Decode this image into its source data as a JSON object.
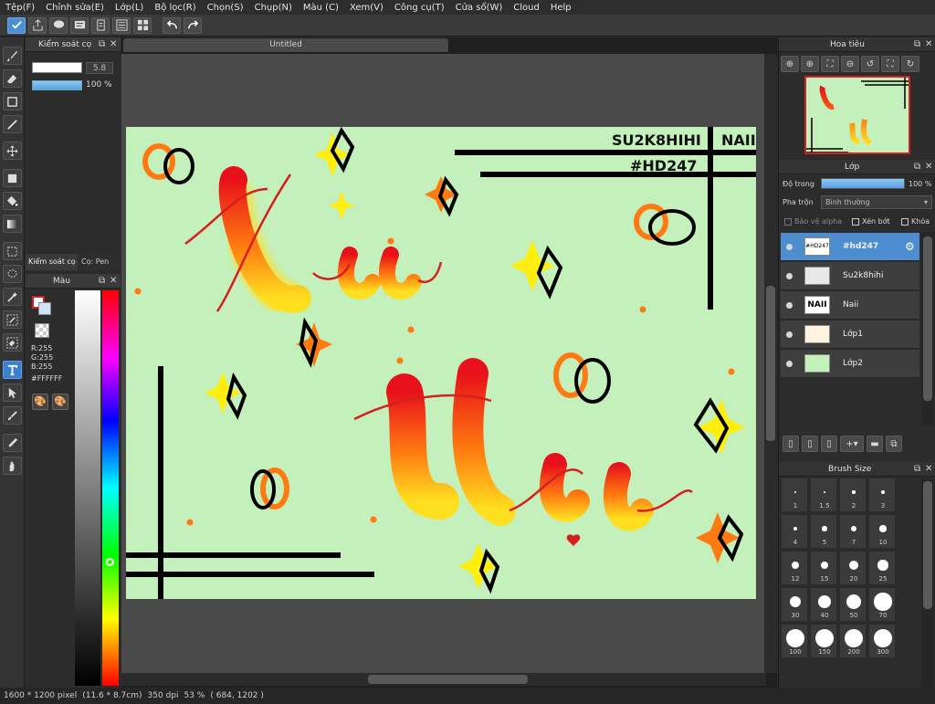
{
  "menu": [
    "Tệp(F)",
    "Chỉnh sửa(E)",
    "Lớp(L)",
    "Bộ lọc(R)",
    "Chọn(S)",
    "Chụp(N)",
    "Màu (C)",
    "Xem(V)",
    "Công cụ(T)",
    "Cửa sổ(W)",
    "Cloud",
    "Help"
  ],
  "brush_control": {
    "title": "Kiểm soát cọ",
    "size": "5.8",
    "opacity": "100 %",
    "tab_brush": "Kiểm soát cọ",
    "tab_pen": "Cọ: Pen"
  },
  "color_panel": {
    "title": "Màu",
    "r": "R:255",
    "g": "G:255",
    "b": "B:255",
    "hex": "#FFFFFF"
  },
  "document": {
    "tab": "Untitled"
  },
  "artwork": {
    "text_top": "SU2K8HIHI",
    "text_naii": "NAII",
    "text_tag": "#HD247"
  },
  "navigator": {
    "title": "Hoa tiêu"
  },
  "layers_panel": {
    "title": "Lớp",
    "opacity_label": "Độ trong",
    "opacity_value": "100 %",
    "blend_label": "Pha trộn",
    "blend_value": "Bình thường",
    "protect_alpha": "Bảo vệ alpha",
    "clip": "Xén bớt",
    "lock": "Khóa",
    "layers": [
      {
        "name": "#hd247"
      },
      {
        "name": "Su2k8hihi"
      },
      {
        "name": "Naii"
      },
      {
        "name": "Lớp1"
      },
      {
        "name": "Lớp2"
      }
    ]
  },
  "brush_size": {
    "title": "Brush Size",
    "sizes": [
      "1",
      "1.5",
      "2",
      "3",
      "4",
      "5",
      "7",
      "10",
      "12",
      "15",
      "20",
      "25",
      "30",
      "40",
      "50",
      "70",
      "100",
      "150",
      "200",
      "300"
    ]
  },
  "status": {
    "dimensions": "1600 * 1200 pixel",
    "physical": "(11.6 * 8.7cm)",
    "dpi": "350 dpi",
    "zoom": "53 %",
    "cursor": "( 684, 1202 )"
  }
}
